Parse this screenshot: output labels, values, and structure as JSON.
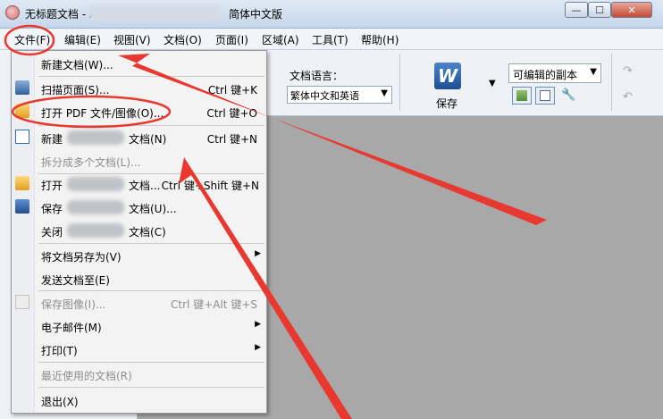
{
  "window": {
    "title": "无标题文档 - A",
    "title_tail": "简体中文版",
    "minimize": "—",
    "maximize": "☐",
    "close": "✕"
  },
  "menubar": {
    "file": "文件(F)",
    "edit": "编辑(E)",
    "view": "视图(V)",
    "document": "文档(O)",
    "page": "页面(I)",
    "area": "区域(A)",
    "tools": "工具(T)",
    "help": "帮助(H)"
  },
  "toolbar": {
    "lang_label": "文档语言：",
    "lang_value": "繁体中文和英语",
    "save_icon_letter": "W",
    "save_label": "保存",
    "copy_value": "可编辑的副本",
    "dropdown_arrow": "▼"
  },
  "file_menu": {
    "new_doc": "新建文档(W)...",
    "scan_page": "扫描页面(S)...",
    "scan_page_shortcut": "Ctrl 键+K",
    "open_pdf": "打开 PDF 文件/图像(O)...",
    "open_pdf_shortcut": "Ctrl 键+O",
    "new_prefix": "新建",
    "new_suffix": "文档(N)",
    "new_shortcut": "Ctrl 键+N",
    "split_doc": "拆分成多个文档(L)...",
    "open_prefix": "打开",
    "open_suffix": "文档...",
    "open_shortcut": "Ctrl 键+Shift 键+N",
    "save_prefix": "保存",
    "save_suffix": "文档(U)...",
    "close_prefix": "关闭",
    "close_suffix": "文档(C)",
    "save_as": "将文档另存为(V)",
    "send_to": "发送文档至(E)",
    "save_image": "保存图像(I)...",
    "save_image_shortcut": "Ctrl 键+Alt 键+S",
    "email": "电子邮件(M)",
    "print": "打印(T)",
    "recent": "最近使用的文档(R)",
    "exit": "退出(X)",
    "submenu_arrow": "▶"
  },
  "colors": {
    "annotation": "#e8382f",
    "disabled_text": "#8e8e8e"
  }
}
